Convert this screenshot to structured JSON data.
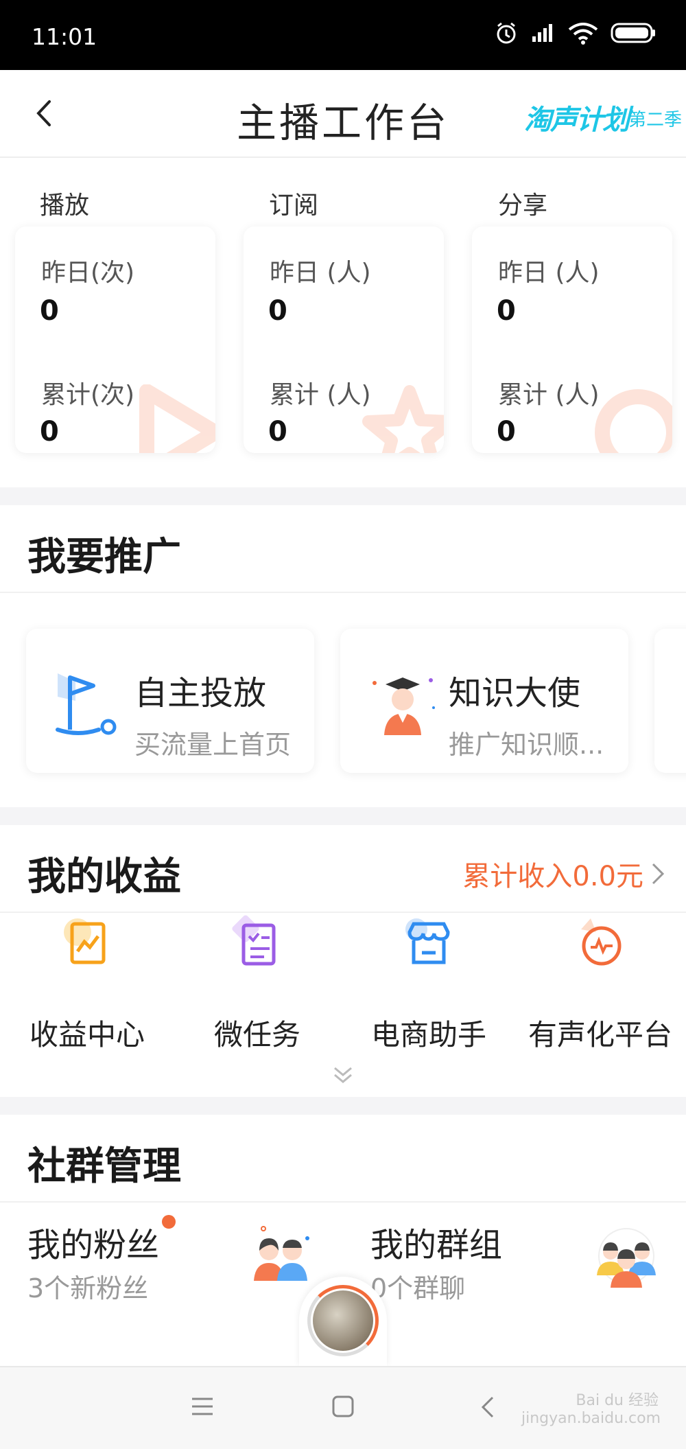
{
  "status_bar": {
    "time": "11:01"
  },
  "header": {
    "title": "主播工作台",
    "brand": "淘声计划",
    "brand_sub": "第二季"
  },
  "stats": {
    "columns": [
      {
        "heading": "播放",
        "yesterday_label": "昨日(次)",
        "yesterday_value": "0",
        "total_label": "累计(次)",
        "total_value": "0"
      },
      {
        "heading": "订阅",
        "yesterday_label": "昨日 (人)",
        "yesterday_value": "0",
        "total_label": "累计 (人)",
        "total_value": "0"
      },
      {
        "heading": "分享",
        "yesterday_label": "昨日 (人)",
        "yesterday_value": "0",
        "total_label": "累计 (人)",
        "total_value": "0"
      }
    ]
  },
  "promote": {
    "title": "我要推广",
    "cards": [
      {
        "title": "自主投放",
        "subtitle": "买流量上首页"
      },
      {
        "title": "知识大使",
        "subtitle": "推广知识顺..."
      }
    ]
  },
  "earnings": {
    "title": "我的收益",
    "total": "累计收入0.0元",
    "items": [
      {
        "label": "收益中心",
        "icon": "chart-icon"
      },
      {
        "label": "微任务",
        "icon": "checklist-icon"
      },
      {
        "label": "电商助手",
        "icon": "store-icon"
      },
      {
        "label": "有声化平台",
        "icon": "pulse-icon"
      }
    ]
  },
  "community": {
    "title": "社群管理",
    "items": [
      {
        "title": "我的粉丝",
        "subtitle": "3个新粉丝"
      },
      {
        "title": "我的群组",
        "subtitle": "0个群聊"
      }
    ]
  },
  "colors": {
    "accent": "#f26b3a",
    "blue": "#2f8cf0",
    "purple": "#9b5de5",
    "orange": "#f7a21a"
  },
  "watermark": "Bai du 经验 jingyan.baidu.com"
}
